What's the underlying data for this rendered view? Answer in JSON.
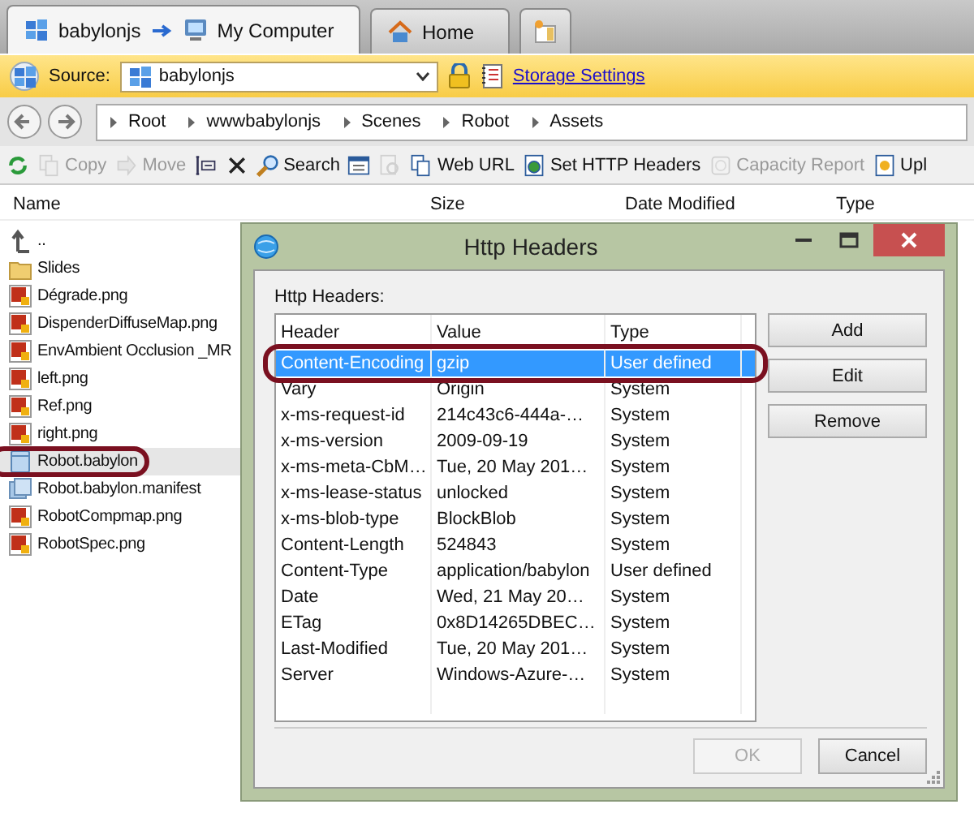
{
  "tabs": [
    {
      "label": "babylonjs",
      "target": "My Computer",
      "selected": true
    },
    {
      "label": "Home",
      "selected": false
    }
  ],
  "source": {
    "label": "Source:",
    "value": "babylonjs",
    "link": "Storage Settings"
  },
  "breadcrumbs": [
    "Root",
    "wwwbabylonjs",
    "Scenes",
    "Robot",
    "Assets"
  ],
  "toolbar": [
    {
      "disabled": false
    },
    {
      "label": "Copy",
      "disabled": true
    },
    {
      "label": "Move",
      "disabled": true
    },
    {
      "disabled": false
    },
    {
      "disabled": false
    },
    {
      "label": "Search",
      "disabled": false
    },
    {
      "disabled": false
    },
    {
      "disabled": true
    },
    {
      "label": "Web URL",
      "disabled": false
    },
    {
      "label": "Set HTTP Headers",
      "disabled": false
    },
    {
      "label": "Capacity Report",
      "disabled": true
    },
    {
      "label": "Upl",
      "disabled": false
    }
  ],
  "columns": [
    "Name",
    "Size",
    "Date Modified",
    "Type"
  ],
  "files": [
    {
      "name": "..",
      "kind": "up",
      "selected": false
    },
    {
      "name": "Slides",
      "kind": "folder",
      "selected": false
    },
    {
      "name": "Dégrade.png",
      "kind": "image",
      "selected": false
    },
    {
      "name": "DispenderDiffuseMap.png",
      "kind": "image",
      "selected": false
    },
    {
      "name": "EnvAmbient Occlusion _MR",
      "kind": "image",
      "selected": false
    },
    {
      "name": "left.png",
      "kind": "image",
      "selected": false
    },
    {
      "name": "Ref.png",
      "kind": "image",
      "selected": false
    },
    {
      "name": "right.png",
      "kind": "image",
      "selected": false
    },
    {
      "name": "Robot.babylon",
      "kind": "babylon",
      "selected": true
    },
    {
      "name": "Robot.babylon.manifest",
      "kind": "manifest",
      "selected": false
    },
    {
      "name": "RobotCompmap.png",
      "kind": "image",
      "selected": false
    },
    {
      "name": "RobotSpec.png",
      "kind": "image",
      "selected": false
    }
  ],
  "dialog": {
    "title": "Http Headers",
    "label": "Http Headers:",
    "columns": [
      "Header",
      "Value",
      "Type"
    ],
    "rows": [
      {
        "cells": [
          "Content-Encoding",
          "gzip",
          "User defined"
        ],
        "selected": true
      },
      {
        "cells": [
          "Vary",
          "Origin",
          "System"
        ],
        "selected": false
      },
      {
        "cells": [
          "x-ms-request-id",
          "214c43c6-444a-…",
          "System"
        ],
        "selected": false
      },
      {
        "cells": [
          "x-ms-version",
          "2009-09-19",
          "System"
        ],
        "selected": false
      },
      {
        "cells": [
          "x-ms-meta-CbM…",
          "Tue, 20 May 201…",
          "System"
        ],
        "selected": false
      },
      {
        "cells": [
          "x-ms-lease-status",
          "unlocked",
          "System"
        ],
        "selected": false
      },
      {
        "cells": [
          "x-ms-blob-type",
          "BlockBlob",
          "System"
        ],
        "selected": false
      },
      {
        "cells": [
          "Content-Length",
          "524843",
          "System"
        ],
        "selected": false
      },
      {
        "cells": [
          "Content-Type",
          "application/babylon",
          "User defined"
        ],
        "selected": false
      },
      {
        "cells": [
          "Date",
          "Wed, 21 May 20…",
          "System"
        ],
        "selected": false
      },
      {
        "cells": [
          "ETag",
          "0x8D14265DBEC…",
          "System"
        ],
        "selected": false
      },
      {
        "cells": [
          "Last-Modified",
          "Tue, 20 May 201…",
          "System"
        ],
        "selected": false
      },
      {
        "cells": [
          "Server",
          "Windows-Azure-…",
          "System"
        ],
        "selected": false
      }
    ],
    "side_buttons": [
      "Add",
      "Edit",
      "Remove"
    ],
    "footer_buttons": [
      {
        "label": "OK",
        "disabled": true
      },
      {
        "label": "Cancel",
        "disabled": false
      }
    ]
  }
}
